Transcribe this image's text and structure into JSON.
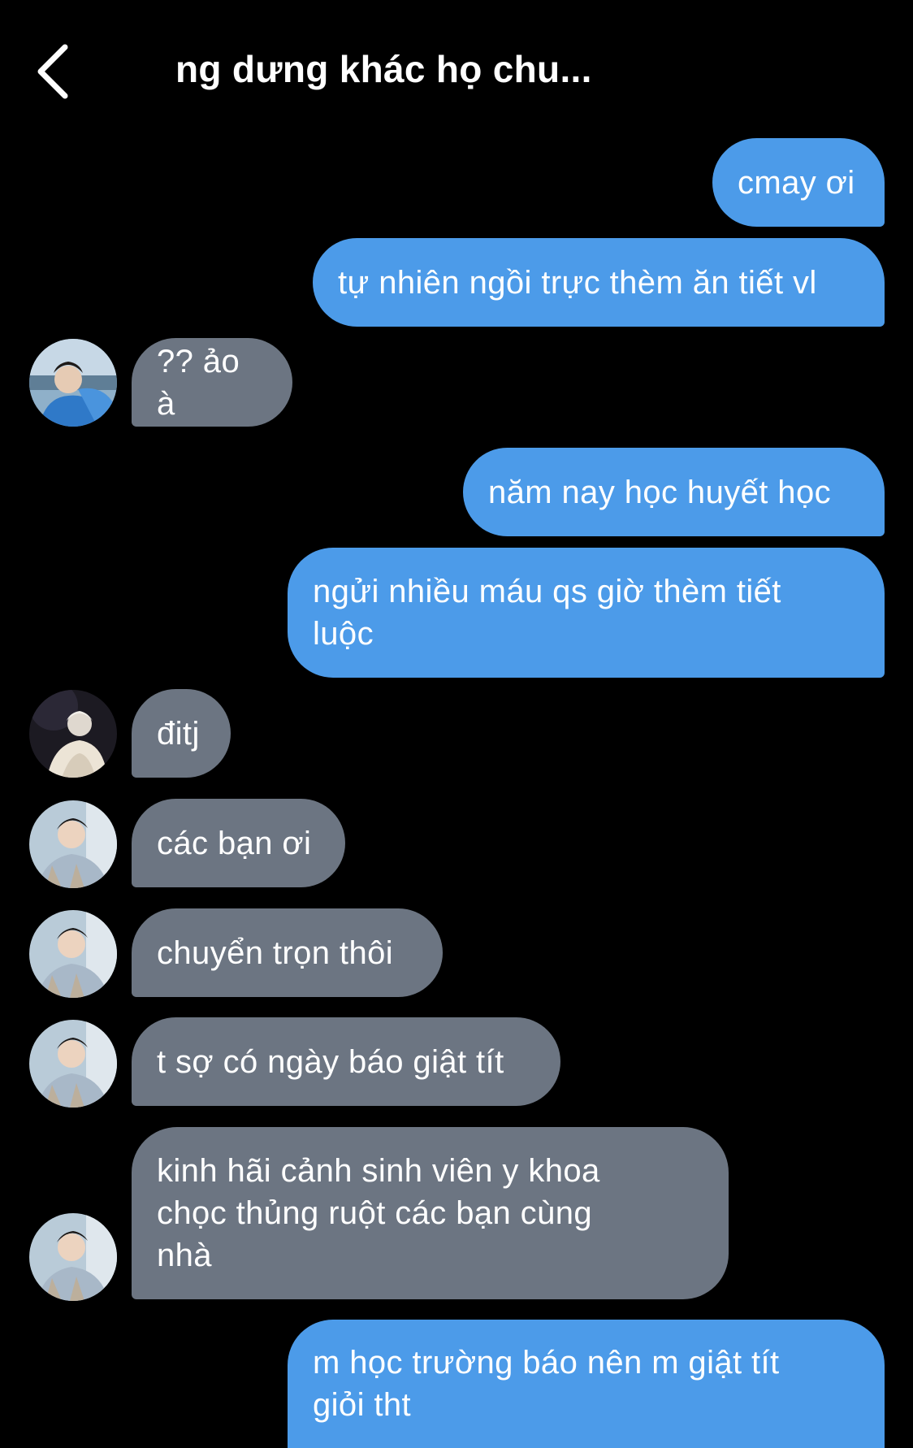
{
  "header": {
    "back_icon": "chevron-left-icon",
    "title": "ng dưng khác họ chu..."
  },
  "colors": {
    "background": "#000000",
    "sent_bubble": "#4c9be9",
    "received_bubble": "#6c7582",
    "text": "#ffffff"
  },
  "messages": [
    {
      "direction": "sent",
      "text": "cmay ơi"
    },
    {
      "direction": "sent",
      "text": "tự nhiên ngồi trực thèm ăn tiết vl"
    },
    {
      "direction": "received",
      "text": "?? ảo à",
      "avatar": "avatar-blue-jacket"
    },
    {
      "direction": "sent",
      "text": "năm nay học huyết học"
    },
    {
      "direction": "sent",
      "text": "ngửi nhiều máu qs giờ thèm tiết\nluộc"
    },
    {
      "direction": "received",
      "text": "đitj",
      "avatar": "avatar-white-hair"
    },
    {
      "direction": "received",
      "text": "các bạn ơi",
      "avatar": "avatar-plaid-shirt"
    },
    {
      "direction": "received",
      "text": "chuyển trọn thôi",
      "avatar": "avatar-plaid-shirt"
    },
    {
      "direction": "received",
      "text": "t sợ có ngày báo giật tít",
      "avatar": "avatar-plaid-shirt"
    },
    {
      "direction": "received",
      "text": "kinh hãi cảnh sinh viên y khoa\nchọc thủng ruột các bạn cùng\nnhà",
      "avatar": "avatar-plaid-shirt"
    },
    {
      "direction": "sent",
      "text": "m học trường báo nên m giật tít\ngiỏi tht"
    }
  ]
}
